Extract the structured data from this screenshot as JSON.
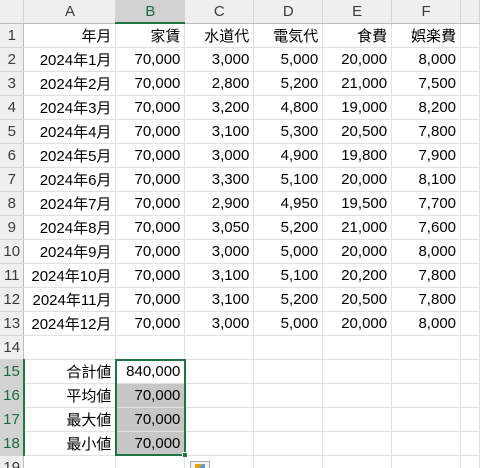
{
  "columns": [
    "A",
    "B",
    "C",
    "D",
    "E",
    "F"
  ],
  "row_numbers": [
    "1",
    "2",
    "3",
    "4",
    "5",
    "6",
    "7",
    "8",
    "9",
    "10",
    "11",
    "12",
    "13",
    "14",
    "15",
    "16",
    "17",
    "18",
    "19"
  ],
  "header_row": [
    "年月",
    "家賃",
    "水道代",
    "電気代",
    "食費",
    "娯楽費"
  ],
  "data_rows": [
    [
      "2024年1月",
      "70,000",
      "3,000",
      "5,000",
      "20,000",
      "8,000"
    ],
    [
      "2024年2月",
      "70,000",
      "2,800",
      "5,200",
      "21,000",
      "7,500"
    ],
    [
      "2024年3月",
      "70,000",
      "3,200",
      "4,800",
      "19,000",
      "8,200"
    ],
    [
      "2024年4月",
      "70,000",
      "3,100",
      "5,300",
      "20,500",
      "7,800"
    ],
    [
      "2024年5月",
      "70,000",
      "3,000",
      "4,900",
      "19,800",
      "7,900"
    ],
    [
      "2024年6月",
      "70,000",
      "3,300",
      "5,100",
      "20,000",
      "8,100"
    ],
    [
      "2024年7月",
      "70,000",
      "2,900",
      "4,950",
      "19,500",
      "7,700"
    ],
    [
      "2024年8月",
      "70,000",
      "3,050",
      "5,200",
      "21,000",
      "7,600"
    ],
    [
      "2024年9月",
      "70,000",
      "3,000",
      "5,000",
      "20,000",
      "8,000"
    ],
    [
      "2024年10月",
      "70,000",
      "3,100",
      "5,100",
      "20,200",
      "7,800"
    ],
    [
      "2024年11月",
      "70,000",
      "3,100",
      "5,200",
      "20,500",
      "7,800"
    ],
    [
      "2024年12月",
      "70,000",
      "3,000",
      "5,000",
      "20,000",
      "8,000"
    ]
  ],
  "summary_rows": [
    {
      "label": "合計値",
      "value": "840,000"
    },
    {
      "label": "平均値",
      "value": "70,000"
    },
    {
      "label": "最大値",
      "value": "70,000"
    },
    {
      "label": "最小値",
      "value": "70,000"
    }
  ],
  "selection": {
    "column": "B",
    "rows": [
      "15",
      "16",
      "17",
      "18"
    ],
    "accent_color": "#217346",
    "range_fill": "#c6c6c6"
  },
  "icons": {
    "quick_analysis": "quick-analysis-icon",
    "fill_handle": "fill-handle-icon"
  }
}
